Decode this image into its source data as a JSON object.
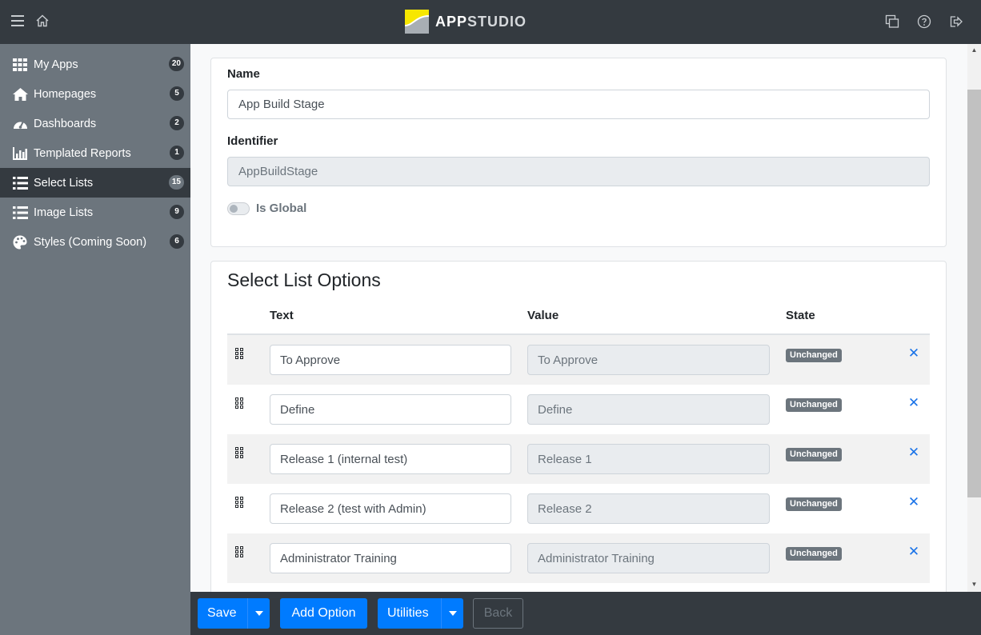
{
  "app": {
    "brand_app": "APP",
    "brand_studio": "STUDIO",
    "accent_color": "#007bff",
    "logo_color": "#f7e700"
  },
  "topbar": {
    "icons": [
      "menu-icon",
      "home-icon",
      "windows-icon",
      "help-icon",
      "sign-out-icon"
    ]
  },
  "sidebar": {
    "items": [
      {
        "label": "My Apps",
        "count": "20",
        "icon": "grid-icon"
      },
      {
        "label": "Homepages",
        "count": "5",
        "icon": "home-icon"
      },
      {
        "label": "Dashboards",
        "count": "2",
        "icon": "gauge-icon"
      },
      {
        "label": "Templated Reports",
        "count": "1",
        "icon": "bar-chart-icon"
      },
      {
        "label": "Select Lists",
        "count": "15",
        "icon": "list-icon",
        "active": true
      },
      {
        "label": "Image Lists",
        "count": "9",
        "icon": "list-icon"
      },
      {
        "label": "Styles (Coming Soon)",
        "count": "6",
        "icon": "palette-icon"
      }
    ]
  },
  "form": {
    "name_label": "Name",
    "name_value": "App Build Stage",
    "identifier_label": "Identifier",
    "identifier_value": "AppBuildStage",
    "global_label": "Is Global",
    "is_global": false
  },
  "options": {
    "title": "Select List Options",
    "headers": {
      "text": "Text",
      "value": "Value",
      "state": "State"
    },
    "rows": [
      {
        "text": "To Approve",
        "value": "To Approve",
        "state": "Unchanged"
      },
      {
        "text": "Define",
        "value": "Define",
        "state": "Unchanged"
      },
      {
        "text": "Release 1 (internal test)",
        "value": "Release 1",
        "state": "Unchanged"
      },
      {
        "text": "Release 2 (test with Admin)",
        "value": "Release 2",
        "state": "Unchanged"
      },
      {
        "text": "Administrator Training",
        "value": "Administrator Training",
        "state": "Unchanged"
      }
    ]
  },
  "toolbar": {
    "save_label": "Save",
    "add_option_label": "Add Option",
    "utilities_label": "Utilities",
    "back_label": "Back"
  }
}
